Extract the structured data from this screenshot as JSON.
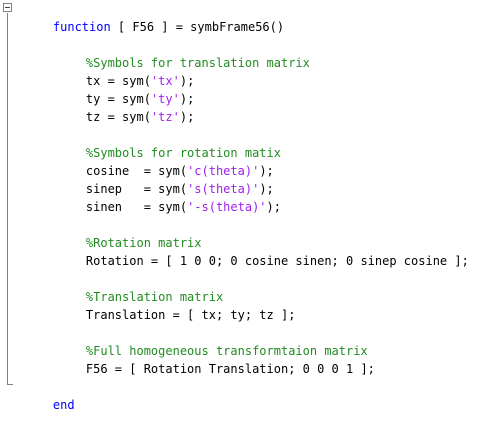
{
  "editor": {
    "header": {
      "keyword": "function",
      "signature": " [ F56 ] = symbFrame56()"
    },
    "translation_section": {
      "comment": "%Symbols for translation matrix",
      "lines": [
        {
          "lhs": "tx = sym(",
          "str": "'tx'",
          "rhs": ");"
        },
        {
          "lhs": "ty = sym(",
          "str": "'ty'",
          "rhs": ");"
        },
        {
          "lhs": "tz = sym(",
          "str": "'tz'",
          "rhs": ");"
        }
      ]
    },
    "rotation_section": {
      "comment": "%Symbols for rotation matix",
      "lines": [
        {
          "lhs": "cosine  = sym(",
          "str": "'c(theta)'",
          "rhs": ");"
        },
        {
          "lhs": "sinep   = sym(",
          "str": "'s(theta)'",
          "rhs": ");"
        },
        {
          "lhs": "sinen   = sym(",
          "str": "'-s(theta)'",
          "rhs": ");"
        }
      ]
    },
    "rotation_matrix": {
      "comment": "%Rotation matrix",
      "code": "Rotation = [ 1 0 0; 0 cosine sinen; 0 sinep cosine ];"
    },
    "translation_matrix": {
      "comment": "%Translation matrix",
      "code": "Translation = [ tx; ty; tz ];"
    },
    "homogeneous": {
      "comment": "%Full homogeneous transformtaion matrix",
      "code": "F56 = [ Rotation Translation; 0 0 0 1 ];"
    },
    "footer": {
      "keyword": "end"
    },
    "colors": {
      "keyword": "#0000ff",
      "comment": "#228b22",
      "string": "#a020f0",
      "text": "#000000",
      "fold_marker": "#808080"
    }
  }
}
